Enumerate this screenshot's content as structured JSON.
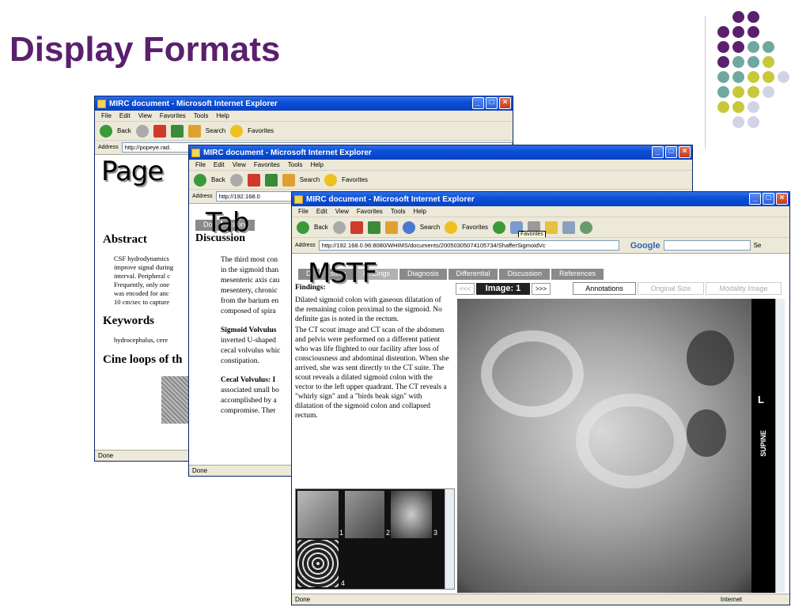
{
  "slide": {
    "title": "Display Formats",
    "dot_colors": {
      "purple": "#5b1f6e",
      "teal": "#6fa8a0",
      "yellow": "#c8c83a",
      "lavender": "#d3d3e6"
    }
  },
  "windows": {
    "back": {
      "title": "MIRC document - Microsoft Internet Explorer",
      "menu": [
        "File",
        "Edit",
        "View",
        "Favorites",
        "Tools",
        "Help"
      ],
      "toolbar": {
        "back": "Back",
        "search": "Search",
        "favorites": "Favorites"
      },
      "address_label": "Address",
      "address": "http://popeye.rad.",
      "headings": {
        "abstract": "Abstract",
        "keywords": "Keywords",
        "cine": "Cine loops of th"
      },
      "abstract_lines": [
        "CSF hydrodynamics",
        "improve signal during",
        "interval. Peripheral c",
        "Frequently, only one",
        "was encoded for anc",
        "10 cm/sec to capture"
      ],
      "keywords_line": "hydrocephalus, cere",
      "status": "Done"
    },
    "middle": {
      "title": "MIRC document - Microsoft Internet Explorer",
      "menu": [
        "File",
        "Edit",
        "View",
        "Favorites",
        "Tools",
        "Help"
      ],
      "toolbar": {
        "back": "Back",
        "search": "Search",
        "favorites": "Favorites"
      },
      "address_label": "Address",
      "address": "http://192.168.0",
      "tabs": [
        "Do",
        "istory"
      ],
      "heading": "Discussion",
      "para1": [
        "The third most con",
        "in the sigmoid than",
        "mesenteric axis cau",
        "mesentery, chronic",
        "from the barium en",
        "composed of spira"
      ],
      "sigmoid_head": "Sigmoid Volvulus",
      "sigmoid_lines": [
        "inverted U-shaped",
        "cecal volvulus whic",
        "constipation."
      ],
      "cecal_head": "Cecal Volvulus: I",
      "cecal_lines": [
        "associated small bo",
        "accomplished by a",
        "compromise. Ther"
      ],
      "status": "Done"
    },
    "front": {
      "title": "MIRC document - Microsoft Internet Explorer",
      "menu": [
        "File",
        "Edit",
        "View",
        "Favorites",
        "Tools",
        "Help"
      ],
      "toolbar": {
        "back": "Back",
        "search": "Search",
        "favorites": "Favorites",
        "tooltip": "Favorites"
      },
      "address_label": "Address",
      "address": "http://192.168.0.96:8080/WHIMS/documents/20050305074105734/ShafferSigmoidVc",
      "google": "Google",
      "search_btn": "Se",
      "tabs": [
        "D",
        "istory",
        "Findings",
        "Diagnosis",
        "Differential",
        "Discussion",
        "References"
      ],
      "image_nav": {
        "prev": "<<<",
        "label": "Image: 1",
        "next": ">>>"
      },
      "image_tabs": [
        "Annotations",
        "Original Size",
        "Modality Image"
      ],
      "findings_heading": "Findings:",
      "findings_p1": "Dilated sigmoid colon with gaseous dilatation of the remaining colon proximal to the sigmoid. No definite gas is noted in the rectum.",
      "findings_p2": "The CT scout image and CT scan of the abdomen and pelvis were performed on a different patient who was life flighted to our facility after loss of consciousness and abdominal distention. When she arrived, she was sent directly to the CT suite. The scout reveals a dilated sigmoid colon with the vector to the left upper quadrant. The CT reveals a \"whirly sign\" and a \"birds beak sign\" with dilatation of the sigmoid colon and collapsed rectum.",
      "thumbs": [
        "1",
        "2",
        "3",
        "4"
      ],
      "xray_labels": {
        "side": "L",
        "position": "SUPINE"
      },
      "status": "Done",
      "zone": "Internet"
    }
  },
  "overlay_labels": {
    "page": "Page",
    "tab": "Tab",
    "mstf": "MSTF"
  }
}
